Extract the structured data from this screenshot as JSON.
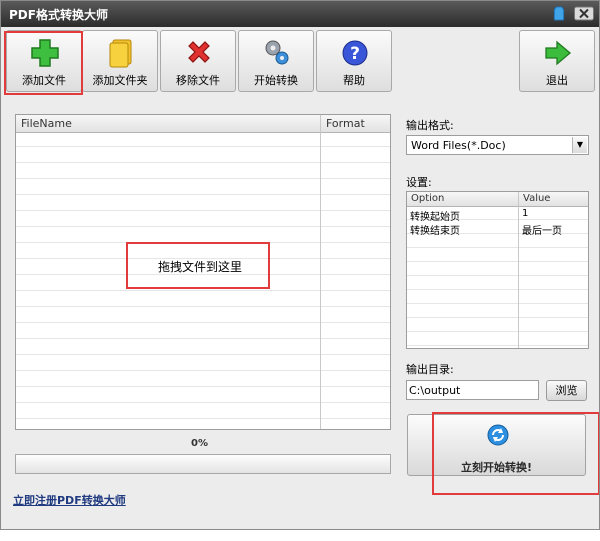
{
  "window": {
    "title": "PDF格式转换大师"
  },
  "toolbar": {
    "add_file": "添加文件",
    "add_folder": "添加文件夹",
    "remove_file": "移除文件",
    "start_convert": "开始转换",
    "help": "帮助",
    "exit": "退出"
  },
  "file_list": {
    "col_filename": "FileName",
    "col_format": "Format",
    "drop_hint": "拖拽文件到这里"
  },
  "progress": {
    "label": "0%",
    "value": 0
  },
  "register_link": "立即注册PDF转换大师",
  "output_format": {
    "label": "输出格式:",
    "selected": "Word Files(*.Doc)"
  },
  "settings": {
    "label": "设置:",
    "col_option": "Option",
    "col_value": "Value",
    "rows": [
      {
        "option": "转换起始页",
        "value": "1"
      },
      {
        "option": "转换结束页",
        "value": "最后一页"
      }
    ]
  },
  "output_dir": {
    "label": "输出目录:",
    "value": "C:\\output",
    "browse": "浏览"
  },
  "start_button": {
    "label": "立刻开始转换!"
  },
  "colors": {
    "highlight": "#e23b3b",
    "title_bar": "#2c2c2c"
  }
}
